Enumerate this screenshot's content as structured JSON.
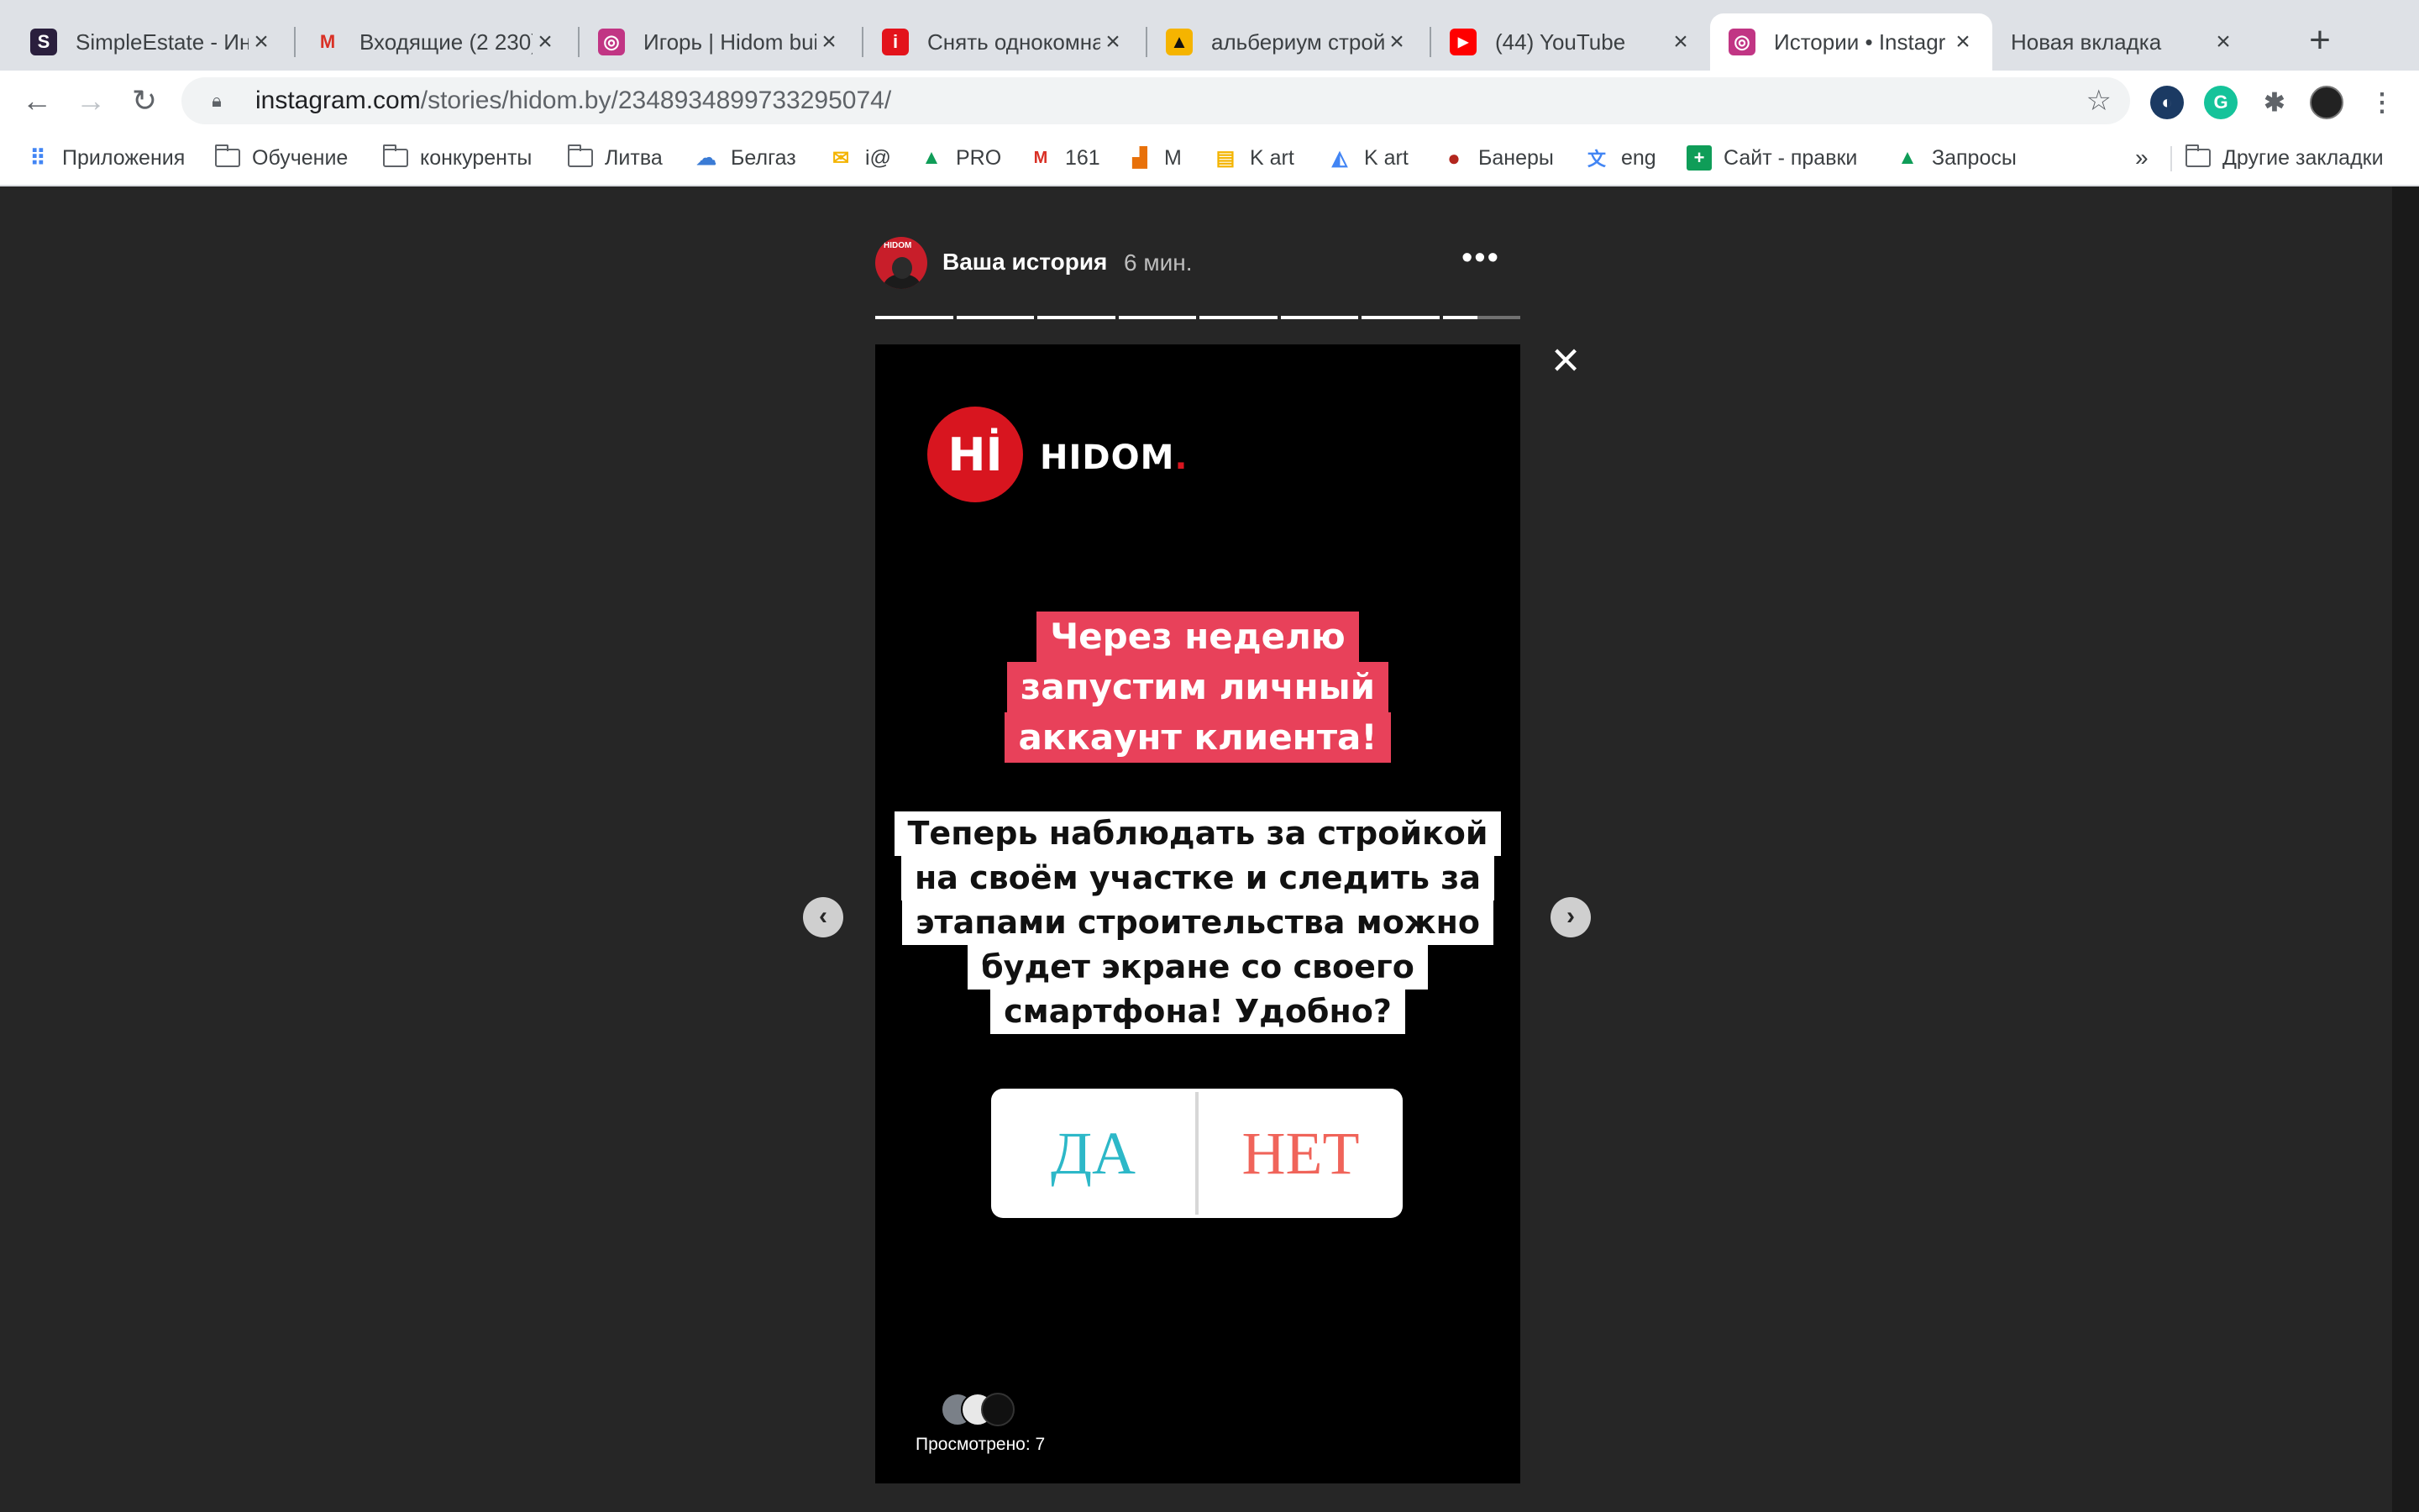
{
  "tabs": [
    {
      "title": "SimpleEstate - Ин",
      "favicon": "S"
    },
    {
      "title": "Входящие (2 230)",
      "favicon": "M"
    },
    {
      "title": "Игорь | Hidom bui",
      "favicon": "◎"
    },
    {
      "title": "Снять однокомна",
      "favicon": "i"
    },
    {
      "title": "альбериум строй",
      "favicon": "▲"
    },
    {
      "title": "(44) YouTube",
      "favicon": "▶"
    },
    {
      "title": "Истории • Instagr",
      "favicon": "◎"
    },
    {
      "title": "Новая вкладка",
      "favicon": ""
    }
  ],
  "address": {
    "domain": "instagram.com",
    "path": "/stories/hidom.by/2348934899733295074/"
  },
  "bookmarks": [
    {
      "label": "Приложения",
      "icon": "apps-grid-icon"
    },
    {
      "label": "Обучение",
      "icon": "folder-icon"
    },
    {
      "label": "конкуренты",
      "icon": "folder-icon"
    },
    {
      "label": "Литва",
      "icon": "folder-icon"
    },
    {
      "label": "Белгаз",
      "icon": "cloud-icon"
    },
    {
      "label": "i@",
      "icon": "mail-icon"
    },
    {
      "label": "PRO",
      "icon": "drive-icon"
    },
    {
      "label": "161",
      "icon": "gmail-icon"
    },
    {
      "label": "М",
      "icon": "bars-icon"
    },
    {
      "label": "K art",
      "icon": "doc-icon"
    },
    {
      "label": "K art",
      "icon": "ads-icon"
    },
    {
      "label": "Банеры",
      "icon": "red-circle-icon"
    },
    {
      "label": "eng",
      "icon": "translate-icon"
    },
    {
      "label": "Сайт - правки",
      "icon": "sheets-icon"
    },
    {
      "label": "Запросы",
      "icon": "drive-icon"
    }
  ],
  "bookmarks_overflow": "»",
  "other_bookmarks": "Другие закладки",
  "story": {
    "username": "Ваша история",
    "time": "6 мин.",
    "more": "•••",
    "segments_total": 8,
    "current_segment_progress": 0.45,
    "logo_mark": "Hİ",
    "logo_text": "HIDOM",
    "logo_dot": ".",
    "headline_lines": [
      "Через неделю",
      "запустим личный",
      "аккаунт клиента!"
    ],
    "body_lines": [
      "Теперь наблюдать за стройкой",
      "на своём участке и следить за",
      "этапами строительства можно",
      "будет экране со своего",
      "смартфона! Удобно?"
    ],
    "poll_yes": "ДА",
    "poll_no": "НЕТ",
    "viewed": "Просмотрено: 7",
    "prev": "‹",
    "next": "›",
    "close": "×"
  },
  "colors": {
    "headline_bg": "#e8415a",
    "logo_red": "#d8151f",
    "poll_yes": "#2db8c8",
    "poll_no": "#f0645a"
  }
}
